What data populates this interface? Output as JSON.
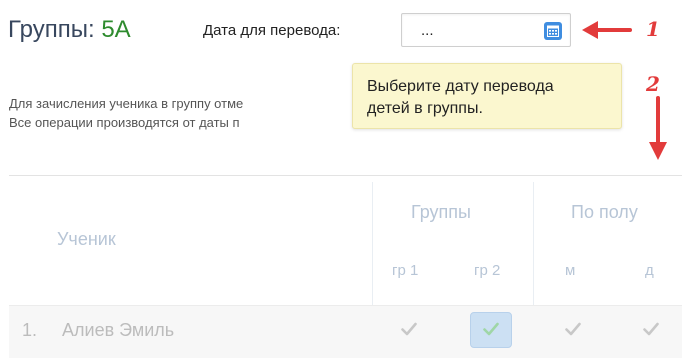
{
  "header": {
    "title_prefix": "Группы:",
    "group_name": "5А"
  },
  "date_field": {
    "label": "Дата для перевода:",
    "value": "..."
  },
  "tooltip": {
    "line1": "Выберите дату перевода",
    "line2": "детей в группы."
  },
  "info": {
    "line1": "Для зачисления ученика в группу отме",
    "line2": "Все операции производятся от даты п"
  },
  "table": {
    "col_student": "Ученик",
    "col_groups": "Группы",
    "col_gender": "По полу",
    "sub": {
      "g1": "гр 1",
      "g2": "гр 2",
      "m": "м",
      "f": "д"
    },
    "rows": [
      {
        "num": "1.",
        "name": "Алиев Эмиль"
      }
    ]
  },
  "annotations": {
    "badge1": "1",
    "badge2": "2"
  },
  "colors": {
    "accent": "#3f8de0",
    "group_green": "#2e8b2e",
    "arrow_red": "#e23b3b",
    "tooltip_bg": "#fbf7cf"
  }
}
